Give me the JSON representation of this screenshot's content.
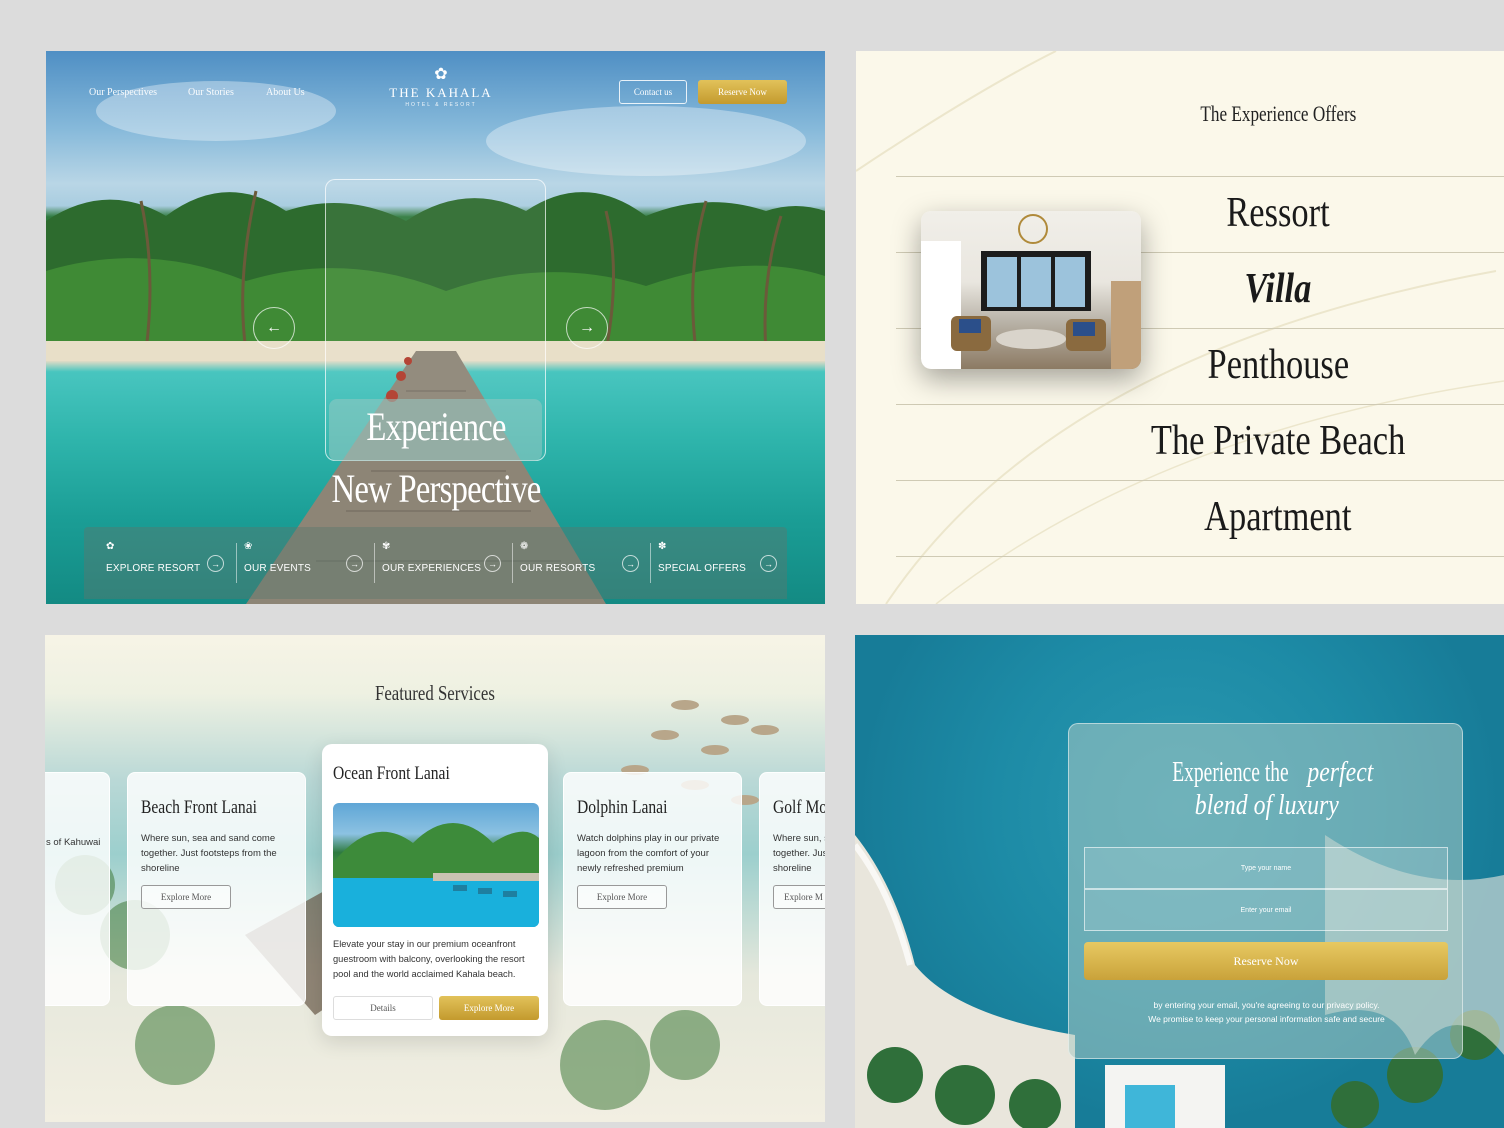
{
  "hero": {
    "nav": [
      "Our Perspectives",
      "Our Stories",
      "About Us"
    ],
    "logo": {
      "name": "THE KAHALA",
      "sub": "HOTEL & RESORT"
    },
    "contact_label": "Contact us",
    "reserve_label": "Reserve Now",
    "title_line1": "Experience",
    "title_line2": "New Perspective",
    "prev_arrow": "←",
    "next_arrow": "→",
    "menu": [
      {
        "icon": "✿",
        "label": "EXPLORE RESORT"
      },
      {
        "icon": "❀",
        "label": "OUR EVENTS"
      },
      {
        "icon": "✾",
        "label": "OUR EXPERIENCES"
      },
      {
        "icon": "❁",
        "label": "OUR RESORTS"
      },
      {
        "icon": "✽",
        "label": "SPECIAL OFFERS"
      }
    ]
  },
  "offers": {
    "title": "The Experience Offers",
    "items": [
      "Ressort",
      "Villa",
      "Penthouse",
      "The Private Beach",
      "Apartment"
    ],
    "active": "Villa"
  },
  "services": {
    "title": "Featured Services",
    "partial_left_text": "s of Kahuwai",
    "cards": [
      {
        "title": "Beach Front Lanai",
        "desc": "Where sun, sea and sand come together. Just footsteps from the shoreline",
        "button": "Explore More"
      },
      {
        "title": "Ocean Front Lanai",
        "desc": "Elevate your stay in our premium oceanfront guestroom with balcony, overlooking the resort pool and the world acclaimed Kahala beach.",
        "details": "Details",
        "button": "Explore More"
      },
      {
        "title": "Dolphin Lanai",
        "desc": "Watch dolphins play in our private lagoon from the comfort of your newly refreshed premium",
        "button": "Explore More"
      },
      {
        "title": "Golf Mo",
        "desc": "Where sun, s together. Jus shoreline",
        "button": "Explore M"
      }
    ]
  },
  "reserve": {
    "title_plain": "Experience the",
    "title_italic1": "perfect",
    "title_italic2": "blend of luxury",
    "name_placeholder": "Type your name",
    "email_placeholder": "Enter your email",
    "button": "Reserve Now",
    "note_line1": "by entering your email, you're agreeing to our privacy policy.",
    "note_line2": "We promise to keep your personal information safe and secure"
  },
  "colors": {
    "gold": "#c9a23a",
    "cream": "#fbf8ea",
    "sea": "#1d8ba6"
  }
}
